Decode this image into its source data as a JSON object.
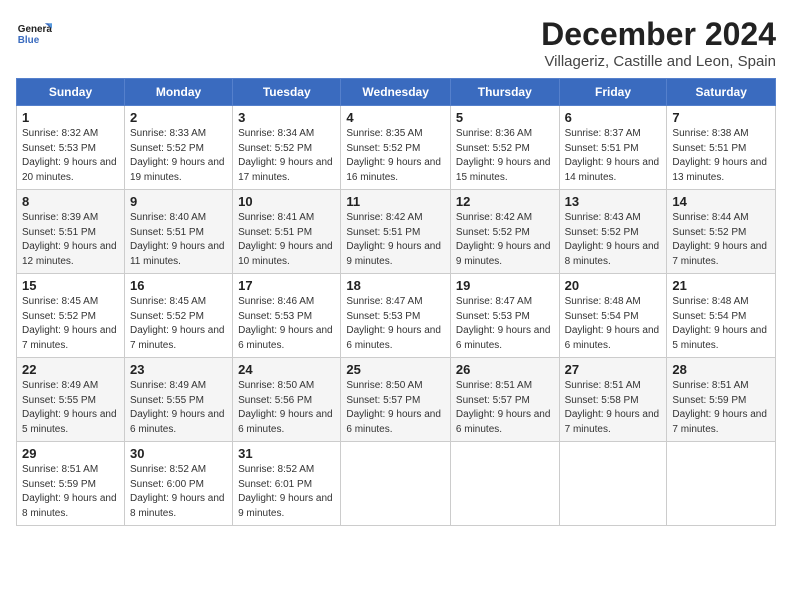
{
  "header": {
    "logo_line1": "General",
    "logo_line2": "Blue",
    "month": "December 2024",
    "location": "Villageriz, Castille and Leon, Spain"
  },
  "weekdays": [
    "Sunday",
    "Monday",
    "Tuesday",
    "Wednesday",
    "Thursday",
    "Friday",
    "Saturday"
  ],
  "weeks": [
    [
      {
        "day": "1",
        "sunrise": "Sunrise: 8:32 AM",
        "sunset": "Sunset: 5:53 PM",
        "daylight": "Daylight: 9 hours and 20 minutes."
      },
      {
        "day": "2",
        "sunrise": "Sunrise: 8:33 AM",
        "sunset": "Sunset: 5:52 PM",
        "daylight": "Daylight: 9 hours and 19 minutes."
      },
      {
        "day": "3",
        "sunrise": "Sunrise: 8:34 AM",
        "sunset": "Sunset: 5:52 PM",
        "daylight": "Daylight: 9 hours and 17 minutes."
      },
      {
        "day": "4",
        "sunrise": "Sunrise: 8:35 AM",
        "sunset": "Sunset: 5:52 PM",
        "daylight": "Daylight: 9 hours and 16 minutes."
      },
      {
        "day": "5",
        "sunrise": "Sunrise: 8:36 AM",
        "sunset": "Sunset: 5:52 PM",
        "daylight": "Daylight: 9 hours and 15 minutes."
      },
      {
        "day": "6",
        "sunrise": "Sunrise: 8:37 AM",
        "sunset": "Sunset: 5:51 PM",
        "daylight": "Daylight: 9 hours and 14 minutes."
      },
      {
        "day": "7",
        "sunrise": "Sunrise: 8:38 AM",
        "sunset": "Sunset: 5:51 PM",
        "daylight": "Daylight: 9 hours and 13 minutes."
      }
    ],
    [
      {
        "day": "8",
        "sunrise": "Sunrise: 8:39 AM",
        "sunset": "Sunset: 5:51 PM",
        "daylight": "Daylight: 9 hours and 12 minutes."
      },
      {
        "day": "9",
        "sunrise": "Sunrise: 8:40 AM",
        "sunset": "Sunset: 5:51 PM",
        "daylight": "Daylight: 9 hours and 11 minutes."
      },
      {
        "day": "10",
        "sunrise": "Sunrise: 8:41 AM",
        "sunset": "Sunset: 5:51 PM",
        "daylight": "Daylight: 9 hours and 10 minutes."
      },
      {
        "day": "11",
        "sunrise": "Sunrise: 8:42 AM",
        "sunset": "Sunset: 5:51 PM",
        "daylight": "Daylight: 9 hours and 9 minutes."
      },
      {
        "day": "12",
        "sunrise": "Sunrise: 8:42 AM",
        "sunset": "Sunset: 5:52 PM",
        "daylight": "Daylight: 9 hours and 9 minutes."
      },
      {
        "day": "13",
        "sunrise": "Sunrise: 8:43 AM",
        "sunset": "Sunset: 5:52 PM",
        "daylight": "Daylight: 9 hours and 8 minutes."
      },
      {
        "day": "14",
        "sunrise": "Sunrise: 8:44 AM",
        "sunset": "Sunset: 5:52 PM",
        "daylight": "Daylight: 9 hours and 7 minutes."
      }
    ],
    [
      {
        "day": "15",
        "sunrise": "Sunrise: 8:45 AM",
        "sunset": "Sunset: 5:52 PM",
        "daylight": "Daylight: 9 hours and 7 minutes."
      },
      {
        "day": "16",
        "sunrise": "Sunrise: 8:45 AM",
        "sunset": "Sunset: 5:52 PM",
        "daylight": "Daylight: 9 hours and 7 minutes."
      },
      {
        "day": "17",
        "sunrise": "Sunrise: 8:46 AM",
        "sunset": "Sunset: 5:53 PM",
        "daylight": "Daylight: 9 hours and 6 minutes."
      },
      {
        "day": "18",
        "sunrise": "Sunrise: 8:47 AM",
        "sunset": "Sunset: 5:53 PM",
        "daylight": "Daylight: 9 hours and 6 minutes."
      },
      {
        "day": "19",
        "sunrise": "Sunrise: 8:47 AM",
        "sunset": "Sunset: 5:53 PM",
        "daylight": "Daylight: 9 hours and 6 minutes."
      },
      {
        "day": "20",
        "sunrise": "Sunrise: 8:48 AM",
        "sunset": "Sunset: 5:54 PM",
        "daylight": "Daylight: 9 hours and 6 minutes."
      },
      {
        "day": "21",
        "sunrise": "Sunrise: 8:48 AM",
        "sunset": "Sunset: 5:54 PM",
        "daylight": "Daylight: 9 hours and 5 minutes."
      }
    ],
    [
      {
        "day": "22",
        "sunrise": "Sunrise: 8:49 AM",
        "sunset": "Sunset: 5:55 PM",
        "daylight": "Daylight: 9 hours and 5 minutes."
      },
      {
        "day": "23",
        "sunrise": "Sunrise: 8:49 AM",
        "sunset": "Sunset: 5:55 PM",
        "daylight": "Daylight: 9 hours and 6 minutes."
      },
      {
        "day": "24",
        "sunrise": "Sunrise: 8:50 AM",
        "sunset": "Sunset: 5:56 PM",
        "daylight": "Daylight: 9 hours and 6 minutes."
      },
      {
        "day": "25",
        "sunrise": "Sunrise: 8:50 AM",
        "sunset": "Sunset: 5:57 PM",
        "daylight": "Daylight: 9 hours and 6 minutes."
      },
      {
        "day": "26",
        "sunrise": "Sunrise: 8:51 AM",
        "sunset": "Sunset: 5:57 PM",
        "daylight": "Daylight: 9 hours and 6 minutes."
      },
      {
        "day": "27",
        "sunrise": "Sunrise: 8:51 AM",
        "sunset": "Sunset: 5:58 PM",
        "daylight": "Daylight: 9 hours and 7 minutes."
      },
      {
        "day": "28",
        "sunrise": "Sunrise: 8:51 AM",
        "sunset": "Sunset: 5:59 PM",
        "daylight": "Daylight: 9 hours and 7 minutes."
      }
    ],
    [
      {
        "day": "29",
        "sunrise": "Sunrise: 8:51 AM",
        "sunset": "Sunset: 5:59 PM",
        "daylight": "Daylight: 9 hours and 8 minutes."
      },
      {
        "day": "30",
        "sunrise": "Sunrise: 8:52 AM",
        "sunset": "Sunset: 6:00 PM",
        "daylight": "Daylight: 9 hours and 8 minutes."
      },
      {
        "day": "31",
        "sunrise": "Sunrise: 8:52 AM",
        "sunset": "Sunset: 6:01 PM",
        "daylight": "Daylight: 9 hours and 9 minutes."
      },
      null,
      null,
      null,
      null
    ]
  ]
}
